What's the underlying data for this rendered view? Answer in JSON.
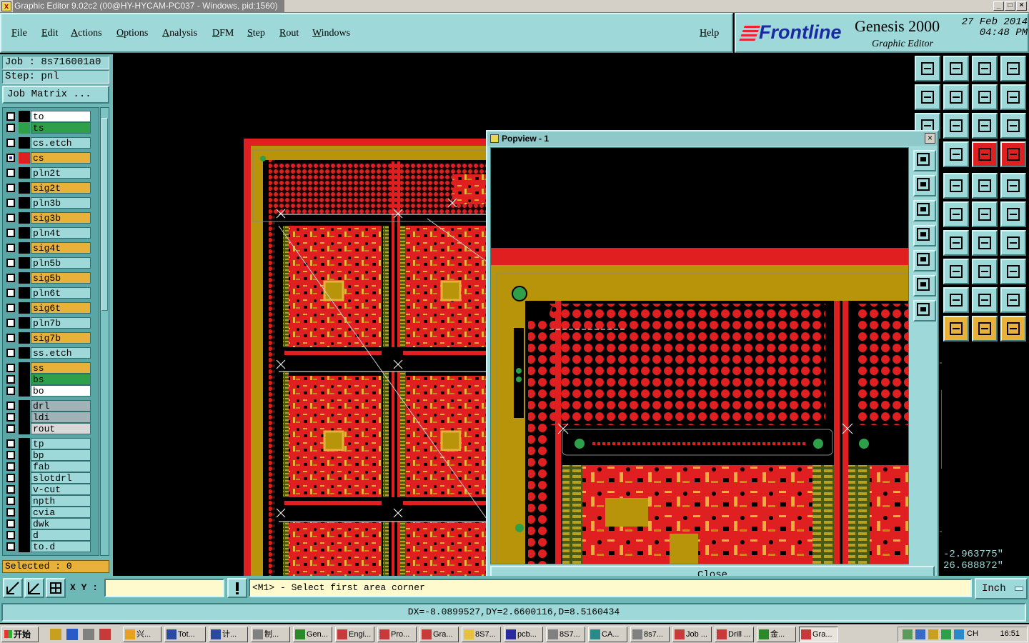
{
  "window": {
    "title": "Graphic Editor 9.02c2 (00@HY-HYCAM-PC037 - Windows, pid:1560)",
    "controls": [
      "_",
      "□",
      "×"
    ]
  },
  "menubar": {
    "items": [
      "File",
      "Edit",
      "Actions",
      "Options",
      "Analysis",
      "DFM",
      "Step",
      "Rout",
      "Windows"
    ],
    "help": "Help"
  },
  "brand": {
    "logo": "Frontline",
    "product": "Genesis 2000",
    "subtitle": "Graphic Editor",
    "date": "27 Feb 2014",
    "time": "04:48 PM"
  },
  "leftpanel": {
    "job": "Job : 8s716001a0",
    "step": "Step: pnl",
    "job_matrix": "Job Matrix ...",
    "selected": "Selected : 0"
  },
  "layers": [
    {
      "name": "to",
      "swatch": "#000000",
      "bg": "#ffffff"
    },
    {
      "name": "ts",
      "swatch": "#2ea04a",
      "bg": "#2ea04a"
    },
    {
      "name": "cs.etch",
      "swatch": "#000000",
      "bg": "#9ed8d8"
    },
    {
      "name": "cs",
      "swatch": "#e02020",
      "bg": "#e8b23a",
      "active": true
    },
    {
      "name": "pln2t",
      "swatch": "#000000",
      "bg": "#9ed8d8"
    },
    {
      "name": "sig2t",
      "swatch": "#000000",
      "bg": "#e8b23a"
    },
    {
      "name": "pln3b",
      "swatch": "#000000",
      "bg": "#9ed8d8"
    },
    {
      "name": "sig3b",
      "swatch": "#000000",
      "bg": "#e8b23a"
    },
    {
      "name": "pln4t",
      "swatch": "#000000",
      "bg": "#9ed8d8"
    },
    {
      "name": "sig4t",
      "swatch": "#000000",
      "bg": "#e8b23a"
    },
    {
      "name": "pln5b",
      "swatch": "#000000",
      "bg": "#9ed8d8"
    },
    {
      "name": "sig5b",
      "swatch": "#000000",
      "bg": "#e8b23a"
    },
    {
      "name": "pln6t",
      "swatch": "#000000",
      "bg": "#9ed8d8"
    },
    {
      "name": "sig6t",
      "swatch": "#000000",
      "bg": "#e8b23a"
    },
    {
      "name": "pln7b",
      "swatch": "#000000",
      "bg": "#9ed8d8"
    },
    {
      "name": "sig7b",
      "swatch": "#000000",
      "bg": "#e8b23a"
    },
    {
      "name": "ss.etch",
      "swatch": "#000000",
      "bg": "#9ed8d8"
    },
    {
      "name": "ss",
      "swatch": "#000000",
      "bg": "#e8b23a"
    },
    {
      "name": "bs",
      "swatch": "#000000",
      "bg": "#2ea04a"
    },
    {
      "name": "bo",
      "swatch": "#000000",
      "bg": "#ffffff"
    },
    {
      "name": "drl",
      "swatch": "#000000",
      "bg": "#a0b4b8"
    },
    {
      "name": "ldi",
      "swatch": "#000000",
      "bg": "#a0b4b8"
    },
    {
      "name": "rout",
      "swatch": "#000000",
      "bg": "#d8d8d8"
    },
    {
      "name": "tp",
      "swatch": "#000000",
      "bg": "#9ed8d8"
    },
    {
      "name": "bp",
      "swatch": "#000000",
      "bg": "#9ed8d8"
    },
    {
      "name": "fab",
      "swatch": "#000000",
      "bg": "#9ed8d8"
    },
    {
      "name": "slotdrl",
      "swatch": "#000000",
      "bg": "#9ed8d8"
    },
    {
      "name": "v-cut",
      "swatch": "#000000",
      "bg": "#9ed8d8"
    },
    {
      "name": "npth",
      "swatch": "#000000",
      "bg": "#9ed8d8"
    },
    {
      "name": "cvia",
      "swatch": "#000000",
      "bg": "#9ed8d8"
    },
    {
      "name": "dwk",
      "swatch": "#000000",
      "bg": "#9ed8d8"
    },
    {
      "name": "d",
      "swatch": "#000000",
      "bg": "#9ed8d8"
    },
    {
      "name": "to.d",
      "swatch": "#000000",
      "bg": "#9ed8d8"
    }
  ],
  "popview": {
    "title": "Popview - 1",
    "close_label": "Close"
  },
  "coords": {
    "x": "-2.963775\"",
    "y": "26.688872\""
  },
  "cmdbar": {
    "xy_label": "X Y :",
    "xy_value": "",
    "prompt": "<M1> - Select first area corner",
    "units": "Inch"
  },
  "status": {
    "text": "DX=-8.0899527,DY=2.6600116,D=8.5160434"
  },
  "taskbar": {
    "start": "开始",
    "tasks": [
      "兴...",
      "Tot...",
      "计...",
      "制...",
      "Gen...",
      "Engi...",
      "Pro...",
      "Gra...",
      "8S7...",
      "pcb...",
      "8S7...",
      "CA...",
      "8s7...",
      "Job ...",
      "Drill ...",
      "金...",
      "Gra..."
    ],
    "tray_lang": "CH",
    "clock": "16:51"
  },
  "colors": {
    "panel": "#9ed8d8",
    "panel_dark": "#6fb8b8",
    "copper": "#e02020",
    "board": "#b8940a",
    "highlight": "#e8b23a"
  }
}
